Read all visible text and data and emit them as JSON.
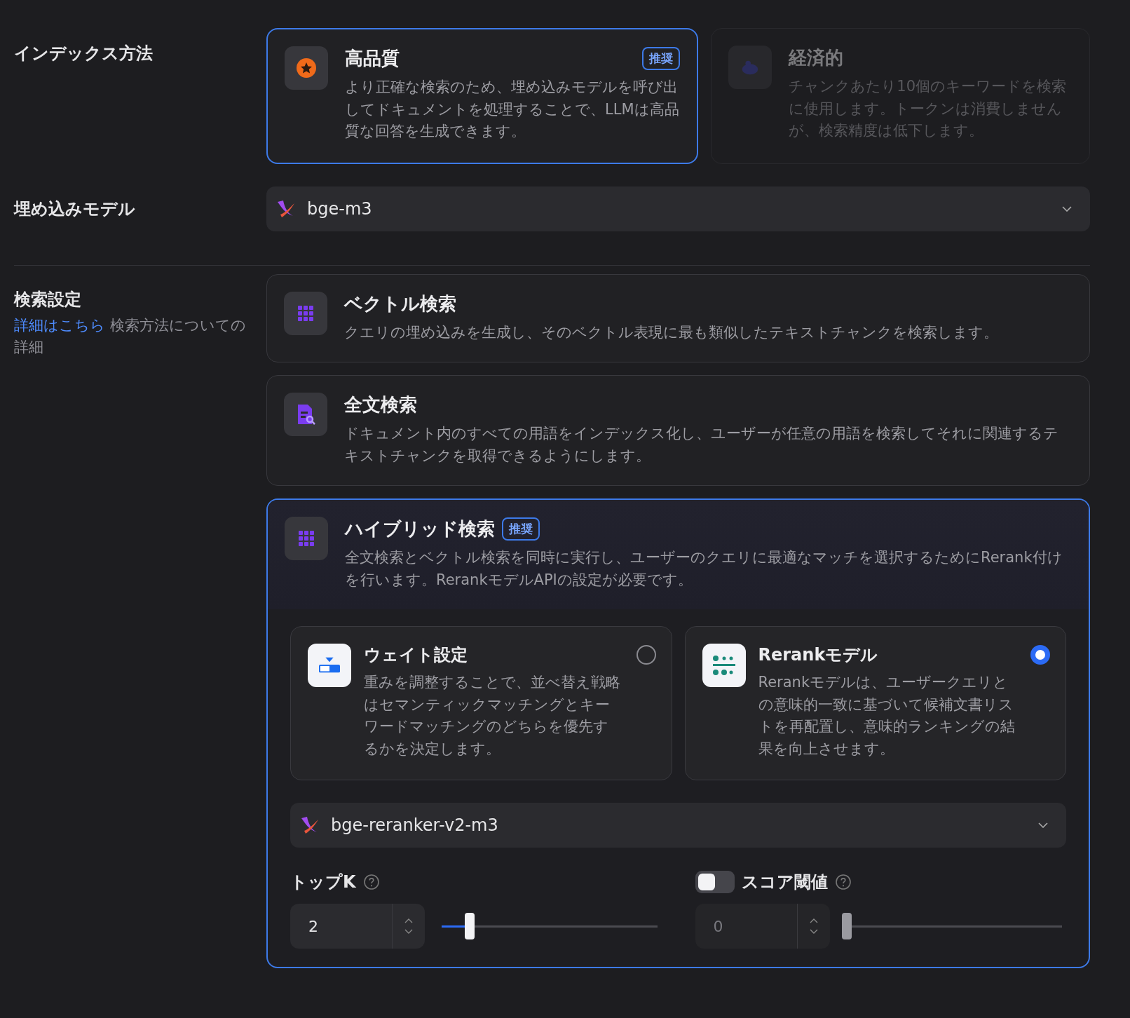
{
  "index_method": {
    "label": "インデックス方法",
    "options": [
      {
        "kind": "high_quality",
        "title": "高品質",
        "badge": "推奨",
        "description": "より正確な検索のため、埋め込みモデルを呼び出してドキュメントを処理することで、LLMは高品質な回答を生成できます。",
        "selected": true,
        "disabled": false
      },
      {
        "kind": "economy",
        "title": "経済的",
        "description": "チャンクあたり10個のキーワードを検索に使用します。トークンは消費しませんが、検索精度は低下します。",
        "selected": false,
        "disabled": true
      }
    ]
  },
  "embedding_model": {
    "label": "埋め込みモデル",
    "value": "bge-m3"
  },
  "retrieval": {
    "label": "検索設定",
    "link": "詳細はこちら",
    "note": "検索方法についての詳細",
    "methods": [
      {
        "kind": "vector",
        "title": "ベクトル検索",
        "description": "クエリの埋め込みを生成し、そのベクトル表現に最も類似したテキストチャンクを検索します。",
        "selected": false
      },
      {
        "kind": "fulltext",
        "title": "全文検索",
        "description": "ドキュメント内のすべての用語をインデックス化し、ユーザーが任意の用語を検索してそれに関連するテキストチャンクを取得できるようにします。",
        "selected": false
      },
      {
        "kind": "hybrid",
        "title": "ハイブリッド検索",
        "badge": "推奨",
        "description": "全文検索とベクトル検索を同時に実行し、ユーザーのクエリに最適なマッチを選択するためにRerank付けを行います。RerankモデルAPIの設定が必要です。",
        "selected": true,
        "settings": {
          "modes": [
            {
              "kind": "weighted",
              "title": "ウェイト設定",
              "description": "重みを調整することで、並べ替え戦略はセマンティックマッチングとキーワードマッチングのどちらを優先するかを決定します。",
              "selected": false
            },
            {
              "kind": "rerank",
              "title": "Rerankモデル",
              "description": "Rerankモデルは、ユーザークエリとの意味的一致に基づいて候補文書リストを再配置し、意味的ランキングの結果を向上させます。",
              "selected": true
            }
          ],
          "rerank_model": "bge-reranker-v2-m3",
          "top_k": {
            "label": "トップK",
            "value": "2",
            "level": 0.13
          },
          "score_threshold": {
            "label": "スコア閾値",
            "on": false,
            "value": "0",
            "level": 0
          }
        }
      }
    ]
  }
}
